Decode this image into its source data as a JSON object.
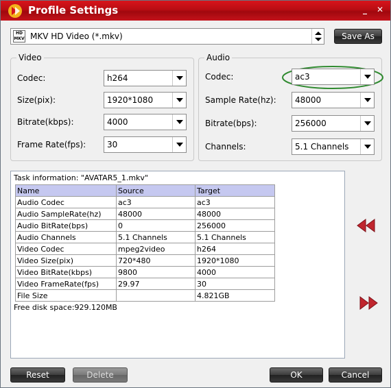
{
  "window": {
    "title": "Profile Settings",
    "minimize": "_",
    "close": "✕"
  },
  "profile": {
    "format": "MKV HD Video (*.mkv)",
    "icon_text": "HD MKV",
    "save_as": "Save As"
  },
  "video": {
    "group_title": "Video",
    "codec_label": "Codec:",
    "codec": "h264",
    "size_label": "Size(pix):",
    "size": "1920*1080",
    "bitrate_label": "Bitrate(kbps):",
    "bitrate": "4000",
    "framerate_label": "Frame Rate(fps):",
    "framerate": "30"
  },
  "audio": {
    "group_title": "Audio",
    "codec_label": "Codec:",
    "codec": "ac3",
    "samplerate_label": "Sample Rate(hz):",
    "samplerate": "48000",
    "bitrate_label": "Bitrate(bps):",
    "bitrate": "256000",
    "channels_label": "Channels:",
    "channels": "5.1 Channels"
  },
  "task": {
    "title": "Task information: \"AVATAR5_1.mkv\"",
    "headers": [
      "Name",
      "Source",
      "Target"
    ],
    "rows": [
      [
        "Audio Codec",
        "ac3",
        "ac3"
      ],
      [
        "Audio SampleRate(hz)",
        "48000",
        "48000"
      ],
      [
        "Audio BitRate(bps)",
        "0",
        "256000"
      ],
      [
        "Audio Channels",
        "5.1 Channels",
        "5.1 Channels"
      ],
      [
        "Video Codec",
        "mpeg2video",
        "h264"
      ],
      [
        "Video Size(pix)",
        "720*480",
        "1920*1080"
      ],
      [
        "Video BitRate(kbps)",
        "9800",
        "4000"
      ],
      [
        "Video FrameRate(fps)",
        "29.97",
        "30"
      ],
      [
        "File Size",
        "",
        "4.821GB"
      ]
    ],
    "disk_space": "Free disk space:929.120MB"
  },
  "buttons": {
    "reset": "Reset",
    "delete": "Delete",
    "ok": "OK",
    "cancel": "Cancel"
  },
  "colors": {
    "titlebar": "#c4121a",
    "nav_arrow": "#c0262e",
    "highlight_ellipse": "#2f8a2f",
    "table_header": "#c5c8f0"
  }
}
